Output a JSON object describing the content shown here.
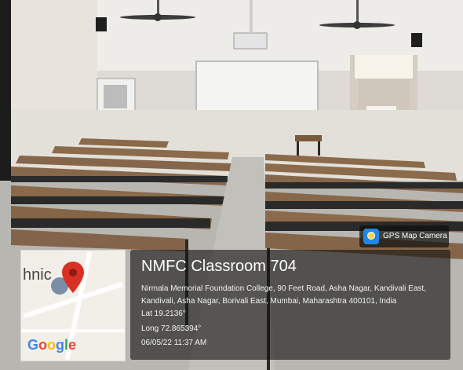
{
  "photo": {
    "map": {
      "label": "hnic",
      "logo": [
        "G",
        "o",
        "o",
        "g",
        "l",
        "e"
      ],
      "logo_colors": [
        "#4285F4",
        "#EA4335",
        "#FBBC05",
        "#4285F4",
        "#34A853",
        "#EA4335"
      ],
      "pin_color": "#d93025"
    },
    "app_badge": {
      "label": "GPS Map Camera",
      "icon": "map-camera-icon"
    },
    "stamp": {
      "title": "NMFC Classroom 704",
      "address": "Nirmala Memorial Foundation College, 90 Feet Road, Asha Nagar, Kandivali East, Kandivali, Asha Nagar, Borivali East, Mumbai, Maharashtra 400101, India",
      "lat": "Lat 19.2136°",
      "long": "Long 72.865394°",
      "datetime": "06/05/22 11:37 AM"
    },
    "scene_colors": {
      "wall": "#e9e6e1",
      "floor": "#bcbab5",
      "desk_top": "#8a6a4a",
      "desk_leg": "#2a2a2a"
    }
  }
}
